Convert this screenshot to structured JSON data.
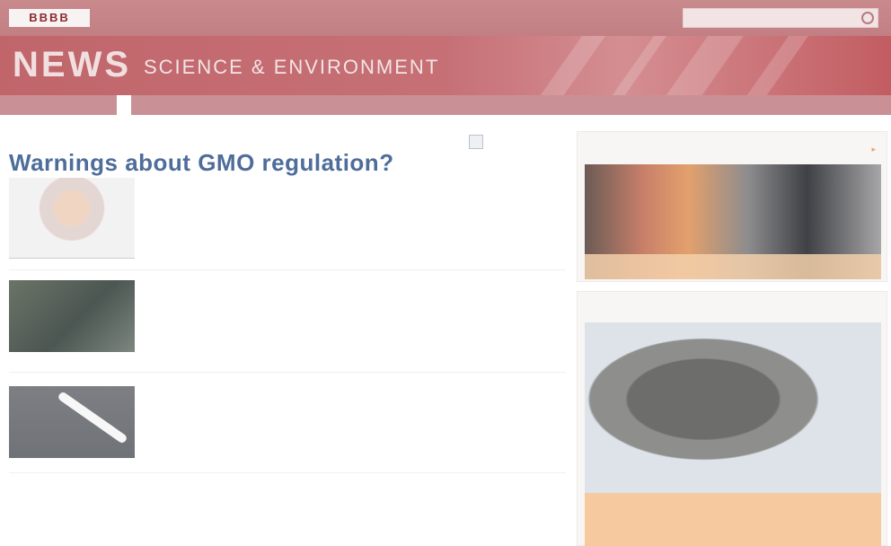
{
  "header": {
    "logo": "BBBB",
    "logo_sub": "",
    "global_nav": [
      "",
      "",
      "",
      "",
      "",
      "",
      ""
    ],
    "search_placeholder": "",
    "banner_title": "NEWS",
    "banner_section": "SCIENCE & ENVIRONMENT",
    "banner_brand": ""
  },
  "section_nav": {
    "items": [
      "",
      "",
      "",
      "",
      "",
      "",
      "",
      "",
      "",
      "",
      ""
    ],
    "active_label": "",
    "active_index": 10
  },
  "main": {
    "timestamp": "",
    "headline": "Warnings about GMO regulation?",
    "lead": {
      "summary": "",
      "link_left": "",
      "link_right": ""
    },
    "stories": [
      {
        "title": "",
        "summary": ""
      },
      {
        "title": "",
        "summary": ""
      }
    ],
    "bottom_left": {
      "title": "",
      "lines": [
        "",
        "",
        ""
      ]
    },
    "bottom_right": {
      "title": "",
      "links": [
        "",
        ""
      ]
    }
  },
  "sidebar": {
    "panel1": {
      "header": "",
      "more": "",
      "caption": ""
    },
    "panel2": {
      "header": "",
      "caption_title": "",
      "caption_sub": ""
    }
  },
  "colors": {
    "brand": "#c0666b",
    "link": "#7fa0c8",
    "headline": "#4e6d9a"
  }
}
